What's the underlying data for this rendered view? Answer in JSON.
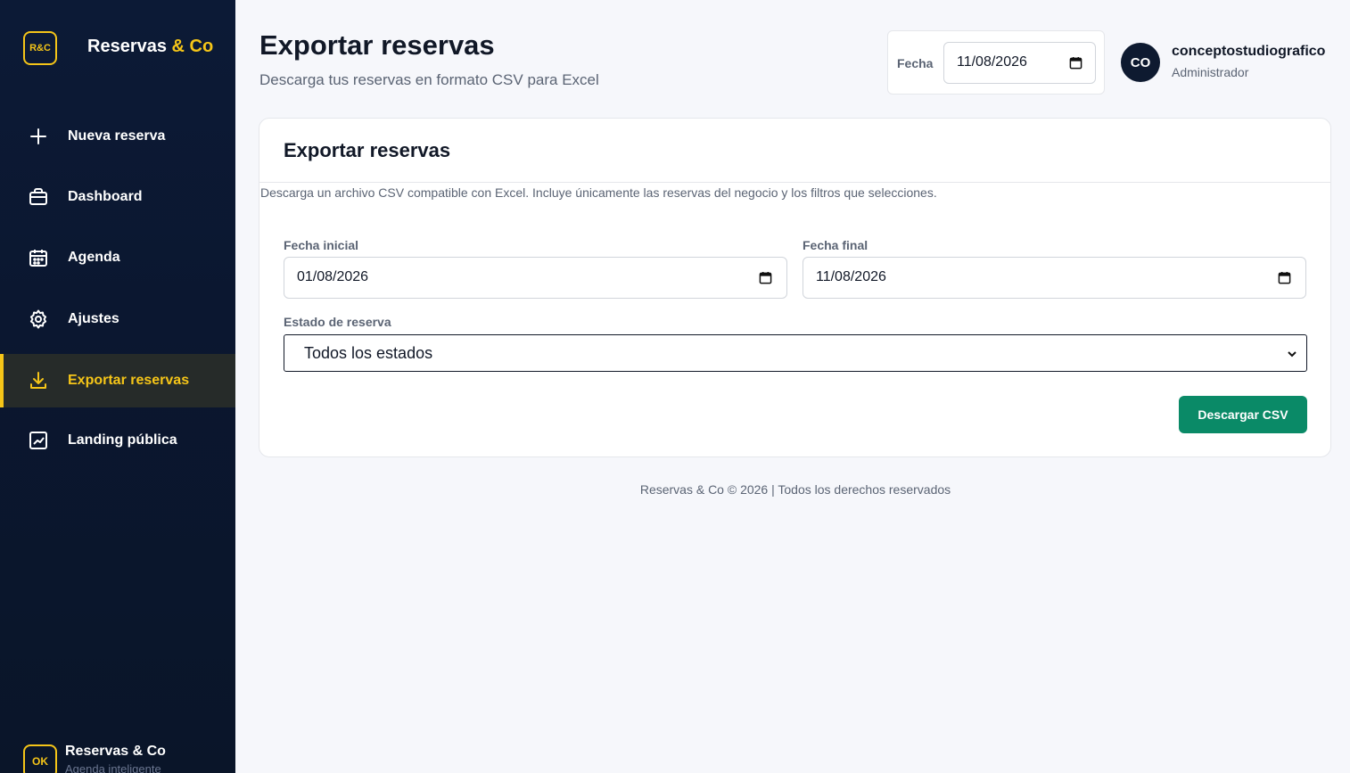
{
  "brand": {
    "badge": "R&C",
    "name_main": "Reservas",
    "name_accent": "& Co",
    "accent_color": "#f5c518"
  },
  "sidebar": {
    "items": [
      {
        "label": "Nueva reserva",
        "icon": "plus-icon",
        "active": false
      },
      {
        "label": "Dashboard",
        "icon": "briefcase-icon",
        "active": false
      },
      {
        "label": "Agenda",
        "icon": "calendar-icon",
        "active": false
      },
      {
        "label": "Ajustes",
        "icon": "gear-icon",
        "active": false
      },
      {
        "label": "Exportar reservas",
        "icon": "download-icon",
        "active": true
      },
      {
        "label": "Landing pública",
        "icon": "chart-icon",
        "active": false
      }
    ],
    "footer": {
      "badge": "OK",
      "title": "Reservas & Co",
      "subtitle": "Agenda inteligente"
    }
  },
  "header": {
    "title": "Exportar reservas",
    "subtitle": "Descarga tus reservas en formato CSV para Excel",
    "date_label": "Fecha",
    "date_value": "11/08/2026"
  },
  "user": {
    "initials": "CO",
    "name": "conceptostudiografico",
    "role": "Administrador"
  },
  "card": {
    "title": "Exportar reservas",
    "description": "Descarga un archivo CSV compatible con Excel. Incluye únicamente las reservas del negocio y los filtros que selecciones.",
    "start_label": "Fecha inicial",
    "start_value": "01/08/2026",
    "end_label": "Fecha final",
    "end_value": "11/08/2026",
    "status_label": "Estado de reserva",
    "status_value": "Todos los estados",
    "download_label": "Descargar CSV",
    "button_color": "#0a8a67"
  },
  "footer": {
    "text": "Reservas & Co © 2026 | Todos los derechos reservados"
  }
}
